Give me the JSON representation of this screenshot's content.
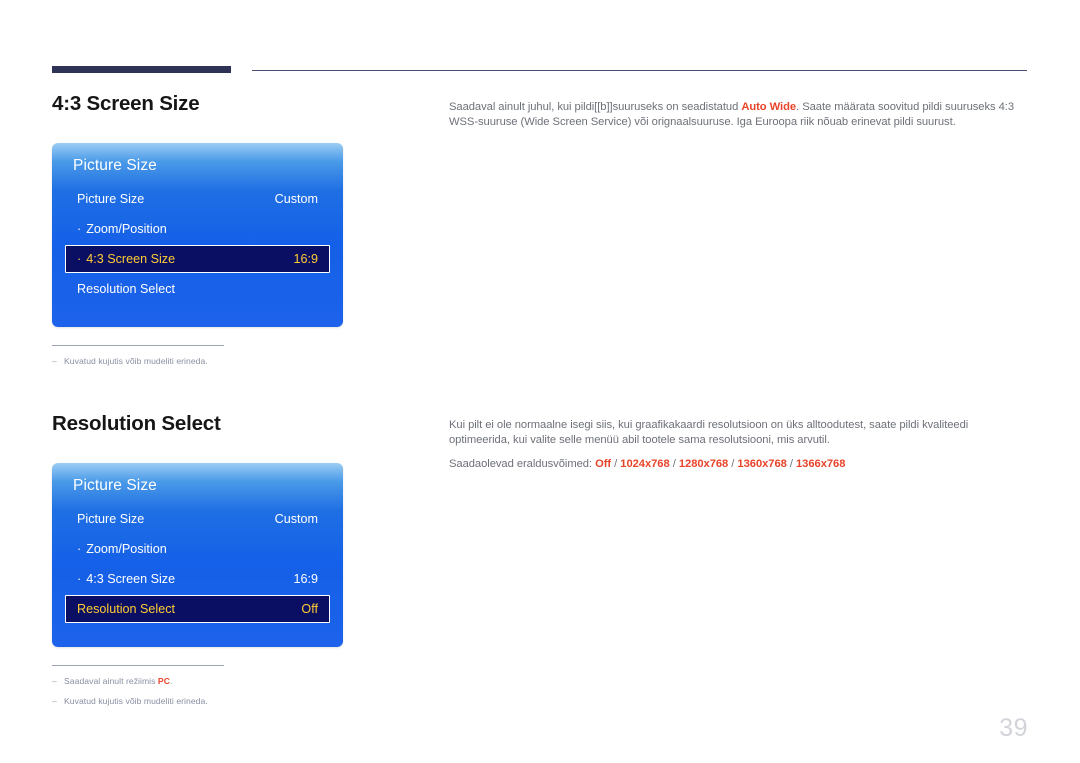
{
  "page": {
    "number": "39"
  },
  "sections": [
    {
      "heading": "4:3 Screen Size",
      "copy": {
        "para1_a": "Saadaval ainult juhul, kui pildi[[b]]suuruseks on seadistatud ",
        "para1_hl": "Auto Wide",
        "para1_b": ". Saate määrata soovitud pildi suuruseks 4:3 WSS-suuruse (Wide Screen Service) või orignaalsuuruse. Iga Euroopa riik nõuab erinevat pildi suurust."
      },
      "osd": {
        "title": "Picture Size",
        "rows": [
          {
            "label": "Picture Size",
            "value": "Custom",
            "indent": false,
            "selected": false
          },
          {
            "label": "Zoom/Position",
            "value": "",
            "indent": true,
            "selected": false
          },
          {
            "label": "4:3 Screen Size",
            "value": "16:9",
            "indent": true,
            "selected": true
          },
          {
            "label": "Resolution Select",
            "value": "",
            "indent": false,
            "selected": false
          }
        ]
      },
      "footnotes": [
        {
          "text": "Kuvatud kujutis võib mudeliti erineda.",
          "highlight": ""
        }
      ]
    },
    {
      "heading": "Resolution Select",
      "copy": {
        "para1": "Kui pilt ei ole normaalne isegi siis, kui graafikakaardi resolutsioon on üks alltoodutest, saate pildi kvaliteedi optimeerida, kui valite selle menüü abil tootele sama resolutsiooni, mis arvutil.",
        "list_label": "Saadaolevad eraldusvõimed: ",
        "list_items": [
          "Off",
          "1024x768",
          "1280x768",
          "1360x768",
          "1366x768"
        ]
      },
      "osd": {
        "title": "Picture Size",
        "rows": [
          {
            "label": "Picture Size",
            "value": "Custom",
            "indent": false,
            "selected": false
          },
          {
            "label": "Zoom/Position",
            "value": "",
            "indent": true,
            "selected": false
          },
          {
            "label": "4:3 Screen Size",
            "value": "16:9",
            "indent": true,
            "selected": false
          },
          {
            "label": "Resolution Select",
            "value": "Off",
            "indent": false,
            "selected": true
          }
        ]
      },
      "footnotes": [
        {
          "text_before": "Saadaval ainult režiimis ",
          "highlight": "PC",
          "text_after": "."
        },
        {
          "text_before": "Kuvatud kujutis võib mudeliti erineda.",
          "highlight": "",
          "text_after": ""
        }
      ]
    }
  ],
  "colors": {
    "accent_red": "#e8442a",
    "osd_blue": "#1560e8",
    "osd_selected_bg": "#0a0f63",
    "osd_selected_text": "#ffcc33",
    "rule_navy": "#2e3356",
    "body_text": "#6d7178"
  }
}
